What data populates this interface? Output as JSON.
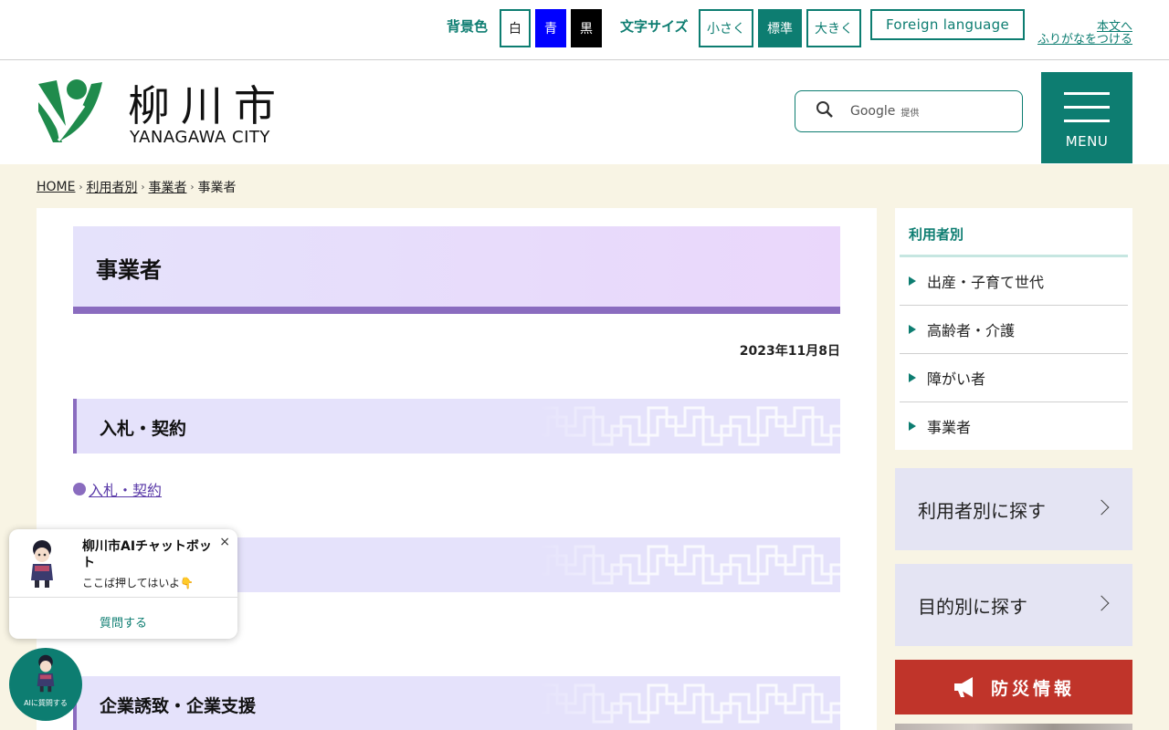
{
  "utility": {
    "bg_label": "背景色",
    "bg_white": "白",
    "bg_blue": "青",
    "bg_black": "黒",
    "fs_label": "文字サイズ",
    "fs_small": "小さく",
    "fs_standard": "標準",
    "fs_large": "大きく",
    "foreign": "Foreign language",
    "skip": "本文へ",
    "furigana": "ふりがなをつける"
  },
  "header": {
    "logo_jp": "柳川市",
    "logo_en": "YANAGAWA CITY",
    "search_google": "Google",
    "search_provided": "提供",
    "menu": "MENU"
  },
  "breadcrumb": {
    "home": "HOME",
    "level1": "利用者別",
    "level2": "事業者",
    "current": "事業者",
    "sep": "›"
  },
  "main": {
    "title": "事業者",
    "date": "2023年11月8日",
    "sections": [
      {
        "heading": "入札・契約",
        "link": "入札・契約"
      },
      {
        "heading": ""
      },
      {
        "heading": "企業誘致・企業支援"
      }
    ]
  },
  "sidebar": {
    "heading": "利用者別",
    "items": [
      {
        "label": "出産・子育て世代"
      },
      {
        "label": "高齢者・介護"
      },
      {
        "label": "障がい者"
      },
      {
        "label": "事業者"
      }
    ],
    "by_user": "利用者別に探す",
    "by_purpose": "目的別に探す",
    "disaster": "防災情報"
  },
  "chatbot": {
    "title": "柳川市AIチャットボット",
    "subtitle": "ここば押してはいよ👇",
    "close": "×",
    "ask": "質問する",
    "fab_label": "AIに質問する"
  },
  "colors": {
    "accent": "#0d7d71",
    "purple": "#8a6cbf",
    "disaster": "#c0342a",
    "bg_cream": "#f8f4e4"
  }
}
